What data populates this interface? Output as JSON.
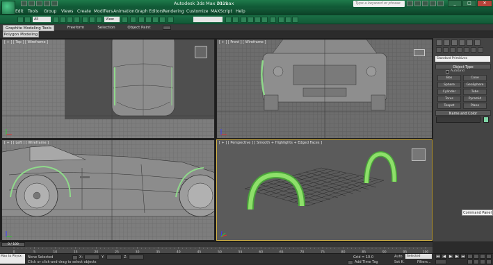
{
  "app": {
    "title": "Autodesk 3ds Max  2011",
    "file_name": "01.max",
    "search_placeholder": "Type a keyword or phrase"
  },
  "window_controls": {
    "minimize": "_",
    "maximize": "□",
    "close": "✕"
  },
  "menu": [
    "Edit",
    "Tools",
    "Group",
    "Views",
    "Create",
    "Modifiers",
    "Animation",
    "Graph Editors",
    "Rendering",
    "Customize",
    "MAXScript",
    "Help"
  ],
  "toolbar": {
    "selection_filter": "All",
    "reference_coord": "View",
    "named_selection": ""
  },
  "ribbon": {
    "tabs": [
      "Graphite Modeling Tools",
      "Freeform",
      "Selection",
      "Object Paint"
    ],
    "active_tab": "Graphite Modeling Tools",
    "sub_tab": "Polygon Modeling"
  },
  "viewports": {
    "top": "[ + ] [ Top ] [ Wireframe ]",
    "front": "[ + ] [ Front ] [ Wireframe ]",
    "left": "[ + ] [ Left ] [ Wireframe ]",
    "perspective": "[ + ] [ Perspective ] [ Smooth + Highlights + Edged Faces ]"
  },
  "command_panel": {
    "dropdown": "Standard Primitives",
    "object_type_heading": "Object Type",
    "autogrid_label": "AutoGrid",
    "buttons": [
      "Box",
      "Cone",
      "Sphere",
      "GeoSphere",
      "Cylinder",
      "Tube",
      "Torus",
      "Pyramid",
      "Teapot",
      "Plane"
    ],
    "name_color_heading": "Name and Color",
    "object_color": "#7fd6a6",
    "tooltip": "Command Panel"
  },
  "timeline": {
    "frame_display": "0 / 100",
    "ticks": [
      "0",
      "5",
      "10",
      "15",
      "20",
      "25",
      "30",
      "35",
      "40",
      "45",
      "50",
      "55",
      "60",
      "65",
      "70",
      "75",
      "80",
      "85",
      "90",
      "95",
      "100"
    ]
  },
  "status": {
    "maxscript_mini": "Max to Physx",
    "selection_info": "None Selected",
    "prompt": "Click or click-and-drag to select objects",
    "grid_info": "Grid = 10.0",
    "add_time_tag": "Add Time Tag",
    "auto_key": "Auto",
    "selected_dropdown": "Selected",
    "set_key": "Set K.",
    "filters": "Filters..."
  }
}
